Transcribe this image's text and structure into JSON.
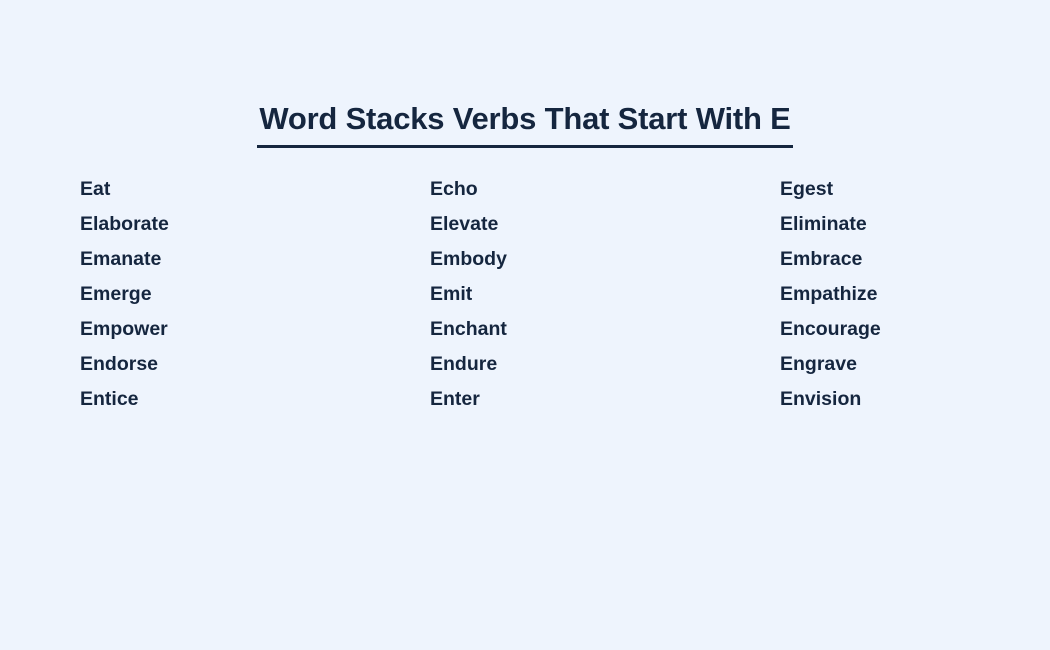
{
  "page": {
    "background_color": "#eef4fd",
    "text_color": "#15263f"
  },
  "header": {
    "title": "Word Stacks Verbs That Start With E"
  },
  "word_list": {
    "columns": [
      {
        "words": [
          "Eat",
          "Elaborate",
          "Emanate",
          "Emerge",
          "Empower",
          "Endorse",
          "Entice"
        ]
      },
      {
        "words": [
          "Echo",
          "Elevate",
          "Embody",
          "Emit",
          "Enchant",
          "Endure",
          "Enter"
        ]
      },
      {
        "words": [
          "Egest",
          "Eliminate",
          "Embrace",
          "Empathize",
          "Encourage",
          "Engrave",
          "Envision"
        ]
      }
    ]
  }
}
